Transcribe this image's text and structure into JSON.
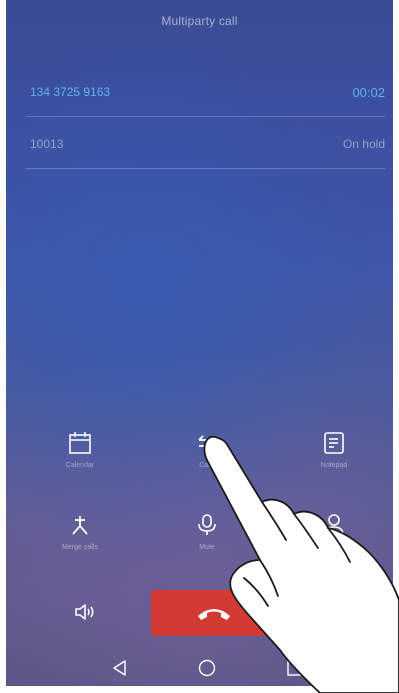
{
  "header": {
    "title": "Multiparty call"
  },
  "calls": [
    {
      "number": "134 3725 9163",
      "status": "00:02"
    },
    {
      "number": "10013",
      "status": "On hold"
    }
  ],
  "controls": {
    "calendar": "Calendar",
    "swap": "Calls",
    "notepad": "Notepad",
    "merge": "Merge calls",
    "mute": "Mute",
    "contacts": "Contacts"
  },
  "colors": {
    "accent": "#5fb4ea",
    "end_call": "#d23a34"
  }
}
